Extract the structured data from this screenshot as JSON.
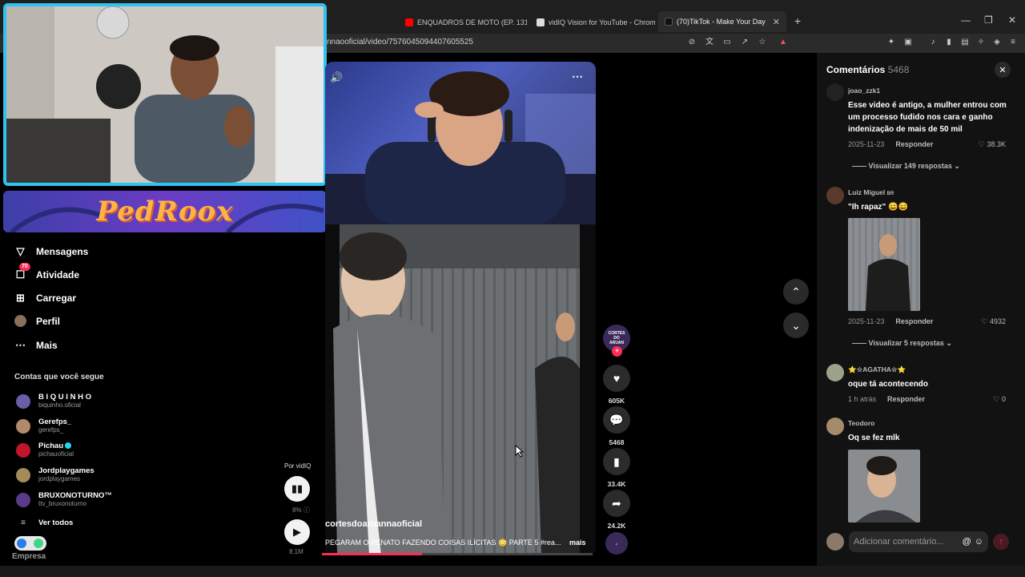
{
  "browser": {
    "tabs": [
      {
        "label": "ENQUADROS DE MOTO (EP. 131) - Yo",
        "icon": "youtube-icon"
      },
      {
        "label": "vidIQ Vision for YouTube - Chrome W",
        "icon": "vidiq-icon"
      },
      {
        "label": "(70)TikTok - Make Your Day",
        "icon": "tiktok-icon",
        "active": true
      }
    ],
    "url": "nnaooficial/video/7576045094407605525",
    "new_tab": "+",
    "window_controls": [
      "—",
      "❐",
      "✕"
    ]
  },
  "overlay": {
    "brand": "PedRoox"
  },
  "sidebar": {
    "nav": [
      {
        "label": "Mensagens",
        "icon": "messages-icon"
      },
      {
        "label": "Atividade",
        "icon": "activity-icon",
        "badge": "70"
      },
      {
        "label": "Carregar",
        "icon": "upload-icon"
      },
      {
        "label": "Perfil",
        "icon": "profile-avatar"
      },
      {
        "label": "Mais",
        "icon": "more-icon"
      }
    ],
    "following_title": "Contas que você segue",
    "accounts": [
      {
        "name": "B I Q U I N H O",
        "handle": "biquinho.oficial",
        "color": "#6b5da8"
      },
      {
        "name": "Gerefps_",
        "handle": "gerefps_",
        "color": "#b08a6a"
      },
      {
        "name": "Pichau",
        "handle": "pichauoficial",
        "color": "#c0152b",
        "verified": true
      },
      {
        "name": "Jordplaygames",
        "handle": "jordplaygames",
        "color": "#a58b5a"
      },
      {
        "name": "BRUXONOTURNO™",
        "handle": "ttv_bruxonoturno",
        "color": "#5a3a8a"
      }
    ],
    "see_all": "Ver todos",
    "footer": "Empresa"
  },
  "video": {
    "author": "cortesdoaruannaoficial",
    "caption": "PEGARAM O RENATO FAZENDO COISAS ILÍCITAS 😳 PARTE 5 #rea...",
    "more": "mais",
    "progress": 0.37
  },
  "actions": {
    "like_count": "605K",
    "comment_count": "5468",
    "save_count": "33.4K",
    "share_count": "24.2K",
    "creator_avatar_text": "CORTES DO ARUAN"
  },
  "vidiq": {
    "label": "Por vidIQ",
    "percent": "8%",
    "views": "8.1M"
  },
  "comments": {
    "title": "Comentários",
    "count": "5468",
    "items": [
      {
        "user": "joao_zzk1",
        "text": "Esse video é antigo, a mulher entrou com um processo fudido nos cara e ganho indenização de mais de 50 mil",
        "date": "2025-11-23",
        "reply": "Responder",
        "likes": "38.3K",
        "replies": "Visualizar 149 respostas"
      },
      {
        "user": "Luiz Miguel",
        "flag": "BR",
        "text": "\"Ih rapaz\" 😄😄",
        "date": "2025-11-23",
        "reply": "Responder",
        "likes": "4932",
        "replies": "Visualizar 5 respostas"
      },
      {
        "user": "⭐☆AGATHA☆⭐",
        "text": "oque tá acontecendo",
        "date": "1 h atrás",
        "reply": "Responder",
        "likes": "0"
      },
      {
        "user": "Teodoro",
        "text": "Oq se fez mlk"
      }
    ],
    "input_placeholder": "Adicionar comentário..."
  }
}
